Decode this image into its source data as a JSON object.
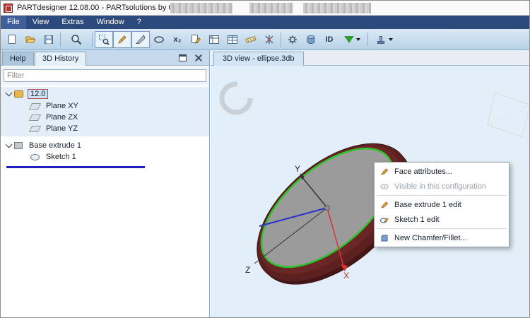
{
  "window": {
    "title": "PARTdesigner 12.08.00 - PARTsolutions by CADENAS"
  },
  "menu_bar": {
    "items": [
      {
        "label": "File"
      },
      {
        "label": "View"
      },
      {
        "label": "Extras"
      },
      {
        "label": "Window"
      },
      {
        "label": "?"
      }
    ]
  },
  "toolbar": {
    "buttons": [
      {
        "name": "new-document-icon"
      },
      {
        "name": "open-folder-icon"
      },
      {
        "name": "save-icon"
      },
      {
        "name": "zoom-icon"
      },
      {
        "name": "zoom-window-icon",
        "pressed": true
      },
      {
        "name": "edit-sketch-icon",
        "pressed": true
      },
      {
        "name": "section-tool-icon",
        "pressed": true
      },
      {
        "name": "ellipse-tool-icon"
      },
      {
        "name": "variables-icon",
        "glyph": "x₂"
      },
      {
        "name": "document-edit-icon"
      },
      {
        "name": "dimension-table-icon"
      },
      {
        "name": "table-icon"
      },
      {
        "name": "measure-icon"
      },
      {
        "name": "axes-icon"
      },
      {
        "name": "settings-icon"
      },
      {
        "name": "part-cylinder-icon"
      },
      {
        "name": "id-button",
        "glyph": "ID"
      },
      {
        "name": "filter-dropdown-button"
      },
      {
        "name": "stamp-dropdown-button"
      }
    ]
  },
  "left_panel": {
    "tabs": [
      {
        "label": "Help",
        "active": false
      },
      {
        "label": "3D History",
        "active": true
      }
    ],
    "filter": {
      "placeholder": "Filter",
      "value": ""
    },
    "tree": [
      {
        "label": "12.0",
        "selected": true
      },
      {
        "label": "Plane XY"
      },
      {
        "label": "Plane ZX"
      },
      {
        "label": "Plane YZ"
      },
      {
        "label": "Base extrude 1"
      },
      {
        "label": "Sketch 1"
      }
    ]
  },
  "main_panel": {
    "tab_label": "3D view - ellipse.3db",
    "axes": {
      "x": "X",
      "y": "Y",
      "z": "Z"
    }
  },
  "context_menu": {
    "items": [
      {
        "label": "Face attributes...",
        "enabled": true
      },
      {
        "label": "Visible in this configuration",
        "enabled": false
      },
      {
        "label": "Base extrude 1 edit",
        "enabled": true
      },
      {
        "label": "Sketch 1 edit",
        "enabled": true
      },
      {
        "label": "New Chamfer/Fillet...",
        "enabled": true
      }
    ]
  },
  "colors": {
    "menu_bar_bg": "#2c4a7c",
    "viewport_bg": "#e2eff8",
    "solid_maroon": "#5c2020",
    "face_gray": "#9b9b9b",
    "highlight_green": "#2bc42b",
    "axis_red": "#e03030",
    "axis_blue": "#2f2fcf",
    "drop_indicator_blue": "#2020c0"
  }
}
